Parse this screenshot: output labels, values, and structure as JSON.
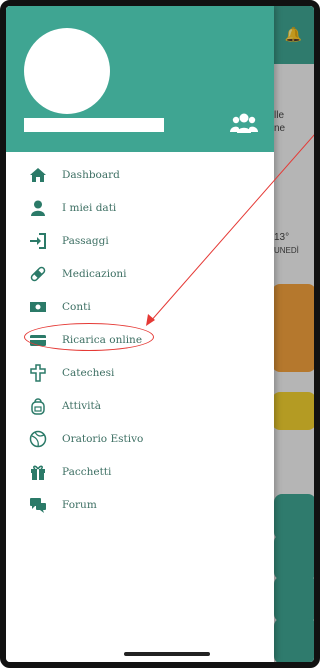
{
  "drawer": {
    "menu": [
      {
        "id": "dashboard",
        "label": "Dashboard",
        "icon": "home-icon"
      },
      {
        "id": "miei-dati",
        "label": "I miei dati",
        "icon": "user-icon"
      },
      {
        "id": "passaggi",
        "label": "Passaggi",
        "icon": "sign-in-icon"
      },
      {
        "id": "medicazioni",
        "label": "Medicazioni",
        "icon": "bandage-icon"
      },
      {
        "id": "conti",
        "label": "Conti",
        "icon": "money-icon"
      },
      {
        "id": "ricarica-online",
        "label": "Ricarica online",
        "icon": "credit-card-icon"
      },
      {
        "id": "catechesi",
        "label": "Catechesi",
        "icon": "cross-icon"
      },
      {
        "id": "attivita",
        "label": "Attività",
        "icon": "backpack-icon"
      },
      {
        "id": "oratorio-estivo",
        "label": "Oratorio Estivo",
        "icon": "ball-icon"
      },
      {
        "id": "pacchetti",
        "label": "Pacchetti",
        "icon": "gift-icon"
      },
      {
        "id": "forum",
        "label": "Forum",
        "icon": "chat-icon"
      }
    ]
  },
  "background": {
    "text_1": "lle",
    "text_2": "ne",
    "weather_temp": "13°",
    "weather_day": "UNEDÌ"
  },
  "colors": {
    "accent": "#3fa592",
    "menu_text": "#3d6f63",
    "annotation": "#e53935"
  }
}
